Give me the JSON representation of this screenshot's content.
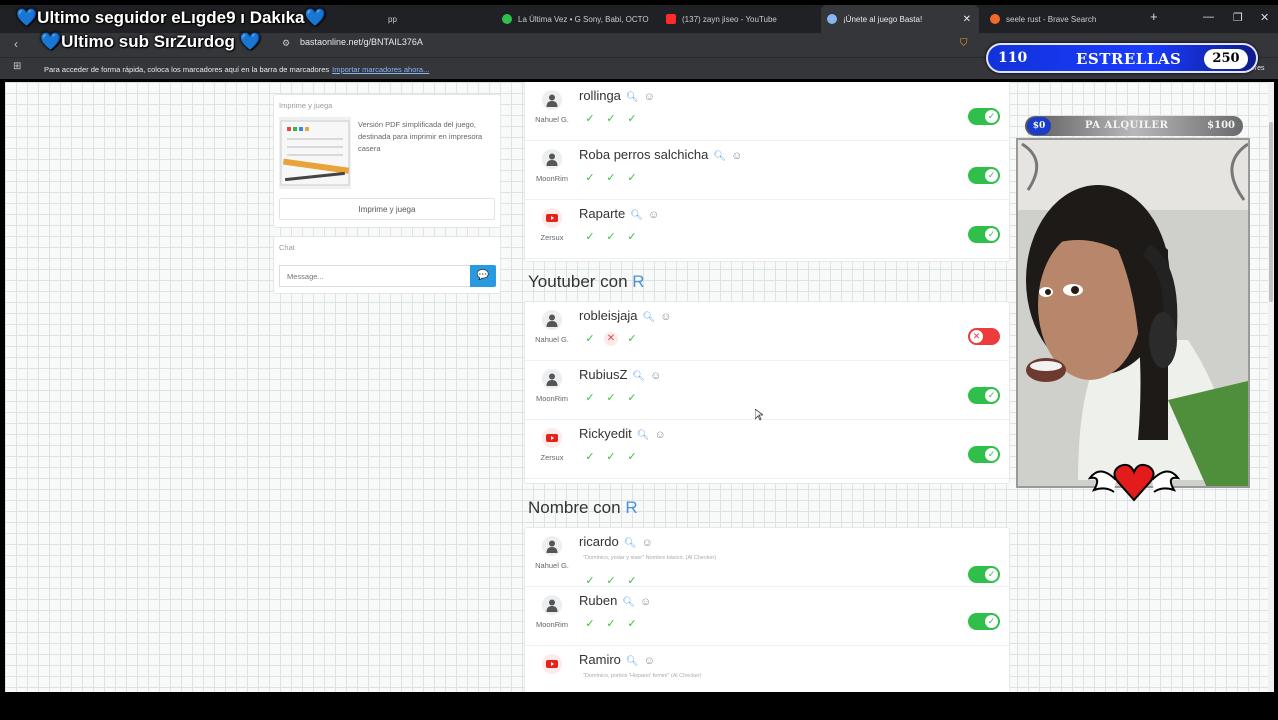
{
  "overlay": {
    "last_follower": "💙Ultimo seguidor  eLıgde9 ı Dakıka💙",
    "last_sub": "💙Ultimo sub  SırZurdog 💙",
    "stars_left": "110",
    "stars_label": "ESTRELLAS",
    "stars_right": "250",
    "rent_left": "$0",
    "rent_label": "PA ALQUILER",
    "rent_price": "$100"
  },
  "browser": {
    "tabs": [
      {
        "label": "La Última Vez • G Sony, Babi, OCTO",
        "color": "#2fbf4a"
      },
      {
        "label": "(137) zayn jiseo - YouTube",
        "color": "#ff2a2a"
      },
      {
        "label": "¡Únete al juego Basta!",
        "color": "#8ab4f8"
      },
      {
        "label": "seele rust - Brave Search",
        "color": "#f06a2a"
      }
    ],
    "tab_partial": "pp",
    "address": "bastaonline.net/g/BNTAIL376A",
    "bookmarks_msg": "Para acceder de forma rápida, coloca los marcadores aquí en la barra de marcadores",
    "bookmarks_link": "Importar marcadores ahora...",
    "other_bookmarks": "Todos los marcadores"
  },
  "sidebar": {
    "print_title": "Imprime y juega",
    "print_desc": "Versión PDF simplificada del juego, destinada para imprimir en impresora casera",
    "print_button": "Imprime y juega",
    "chat_title": "Chat",
    "chat_placeholder": "Message..."
  },
  "categories": [
    {
      "title_prefix": "",
      "letter": "",
      "rows": [
        {
          "word": "rollinga",
          "player": "Nahuel G.",
          "votes": [
            "ok",
            "ok",
            "ok"
          ],
          "accepted": true,
          "youtube": false
        },
        {
          "word": "Roba perros salchicha",
          "player": "MoonRim",
          "votes": [
            "ok",
            "ok",
            "ok"
          ],
          "accepted": true,
          "youtube": false
        },
        {
          "word": "Raparte",
          "player": "Zersux",
          "votes": [
            "ok",
            "ok",
            "ok"
          ],
          "accepted": true,
          "youtube": true
        }
      ]
    },
    {
      "title_prefix": "Youtuber con ",
      "letter": "R",
      "rows": [
        {
          "word": "robleisjaja",
          "player": "Nahuel G.",
          "votes": [
            "ok",
            "no",
            "ok"
          ],
          "accepted": false,
          "youtube": false
        },
        {
          "word": "RubiusZ",
          "player": "MoonRim",
          "votes": [
            "ok",
            "ok",
            "ok"
          ],
          "accepted": true,
          "youtube": false
        },
        {
          "word": "Rickyedit",
          "player": "Zersux",
          "votes": [
            "ok",
            "ok",
            "ok"
          ],
          "accepted": true,
          "youtube": true
        }
      ]
    },
    {
      "title_prefix": "Nombre con ",
      "letter": "R",
      "rows": [
        {
          "word": "ricardo",
          "player": "Nahuel G.",
          "hint": "\"Dominico, yodar y siser\" Nombre básico. (Al Checker)",
          "votes": [
            "ok",
            "ok",
            "ok"
          ],
          "accepted": true,
          "youtube": false
        },
        {
          "word": "Ruben",
          "player": "MoonRim",
          "votes": [
            "ok",
            "ok",
            "ok"
          ],
          "accepted": true,
          "youtube": false
        },
        {
          "word": "Ramiro",
          "player": "",
          "hint": "\"Dominico, portios 'Hispano' femini\" (Al Checker)",
          "votes": [],
          "accepted": null,
          "youtube": true
        }
      ]
    }
  ]
}
